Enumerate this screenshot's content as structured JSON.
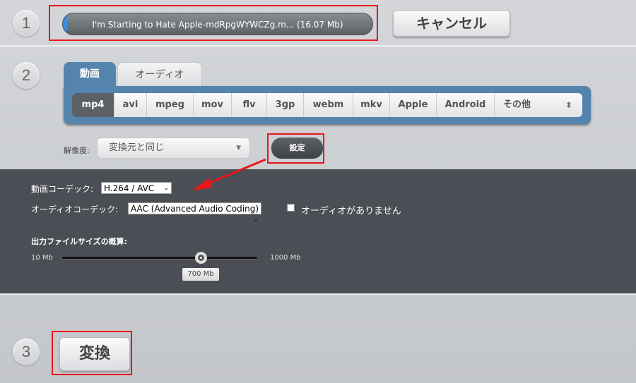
{
  "steps": {
    "one": "1",
    "two": "2",
    "three": "3"
  },
  "file": {
    "name": "I'm Starting to Hate Apple-mdRpgWYWCZg.m... (16.07 Mb)",
    "progress_percent": 1
  },
  "cancel_label": "キャンセル",
  "tabs": [
    {
      "label": "動画",
      "active": true
    },
    {
      "label": "オーディオ",
      "active": false
    }
  ],
  "formats": [
    "mp4",
    "avi",
    "mpeg",
    "mov",
    "flv",
    "3gp",
    "webm",
    "mkv",
    "Apple",
    "Android",
    "その他"
  ],
  "selected_format": "mp4",
  "resolution": {
    "label": "解像度:",
    "value": "変換元と同じ"
  },
  "settings_label": "設定",
  "settings_panel": {
    "video_codec_label": "動画コーデック:",
    "video_codec": "H.264 / AVC",
    "audio_codec_label": "オーディオコーデック:",
    "audio_codec": "AAC (Advanced Audio Coding)",
    "no_audio_label": "オーディオがありません",
    "no_audio_checked": false,
    "size_label": "出力ファイルサイズの概算:",
    "size_min": "10 Mb",
    "size_max": "1000 Mb",
    "size_value": "700 Mb"
  },
  "convert_label": "変換",
  "colors": {
    "accent": "#5483ae",
    "annotation": "#e8161a",
    "panel": "#4b4e54"
  }
}
